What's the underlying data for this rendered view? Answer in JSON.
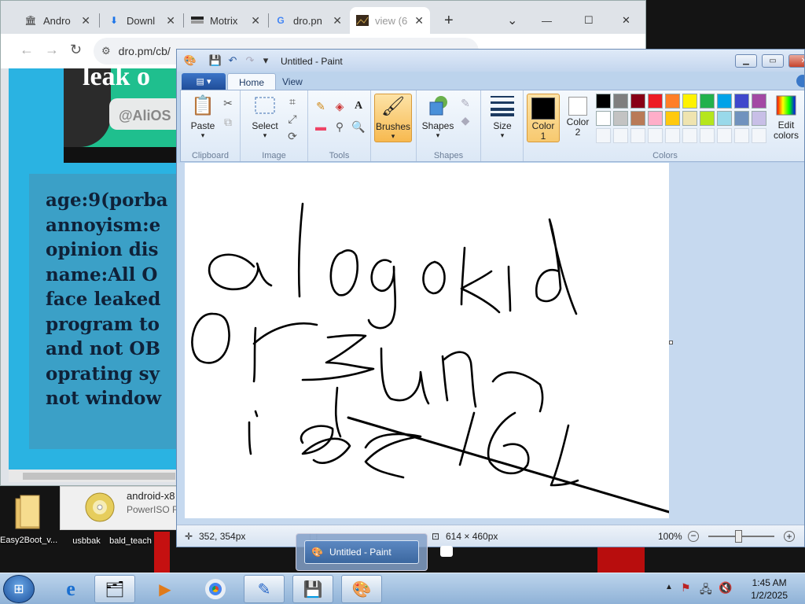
{
  "desktop": {
    "icons": [
      {
        "label": "Easy2Boot_v..."
      },
      {
        "label": "usbbak"
      },
      {
        "label": "bald_teach"
      }
    ]
  },
  "browser": {
    "tabs": [
      {
        "label": "Andro",
        "icon": "bank-icon"
      },
      {
        "label": "Downl",
        "icon": "download-icon"
      },
      {
        "label": "Motrix",
        "icon": "motrix-icon"
      },
      {
        "label": "dro.pn",
        "icon": "google-icon"
      },
      {
        "label": "view (6",
        "icon": "image-icon"
      }
    ],
    "new_tab_label": "+",
    "tab_search_label": "⌄",
    "window_controls": {
      "minimize": "—",
      "maximize": "☐",
      "close": "✕"
    },
    "address": "dro.pm/cb/",
    "page": {
      "image_text_top": "leak o",
      "image_text_bottom": "@AliOS",
      "card_lines": [
        "age:9(porba",
        "annoyism:e",
        "opinion dis",
        "name:All O",
        "face leaked",
        "program to",
        "and not OB",
        "oprating sy",
        "not window"
      ]
    }
  },
  "download_item": {
    "name": "android-x8",
    "subtitle": "PowerISO Fi"
  },
  "paint": {
    "title": "Untitled - Paint",
    "file_tab": "▤ ▾",
    "tabs": [
      "Home",
      "View"
    ],
    "groups": {
      "clipboard": {
        "label": "Clipboard",
        "paste": "Paste"
      },
      "image": {
        "label": "Image",
        "select": "Select"
      },
      "tools": {
        "label": "Tools"
      },
      "brushes": {
        "label": "Brushes"
      },
      "shapes": {
        "label": "Shapes",
        "shapes": "Shapes"
      },
      "size": {
        "label": "Size"
      },
      "colors": {
        "label": "Colors",
        "color1": "Color 1",
        "color2": "Color 2",
        "edit": "Edit colors"
      }
    },
    "palette_row1": [
      "#000000",
      "#7f7f7f",
      "#880015",
      "#ed1c24",
      "#ff7f27",
      "#fff200",
      "#22b14c",
      "#00a2e8",
      "#3f48cc",
      "#a349a4"
    ],
    "palette_row2": [
      "#ffffff",
      "#c3c3c3",
      "#b97a57",
      "#ffaec9",
      "#ffc90e",
      "#efe4b0",
      "#b5e61d",
      "#99d9ea",
      "#7092be",
      "#c8bfe7"
    ],
    "color1_value": "#000000",
    "color2_value": "#ffffff",
    "status": {
      "cursor_pos": "352, 354px",
      "canvas_size": "614 × 460px",
      "zoom": "100%"
    },
    "zoom_level": 100
  },
  "taskbar": {
    "popup_label": "Untitled - Paint",
    "clock_time": "1:45 AM",
    "clock_date": "1/2/2025"
  }
}
